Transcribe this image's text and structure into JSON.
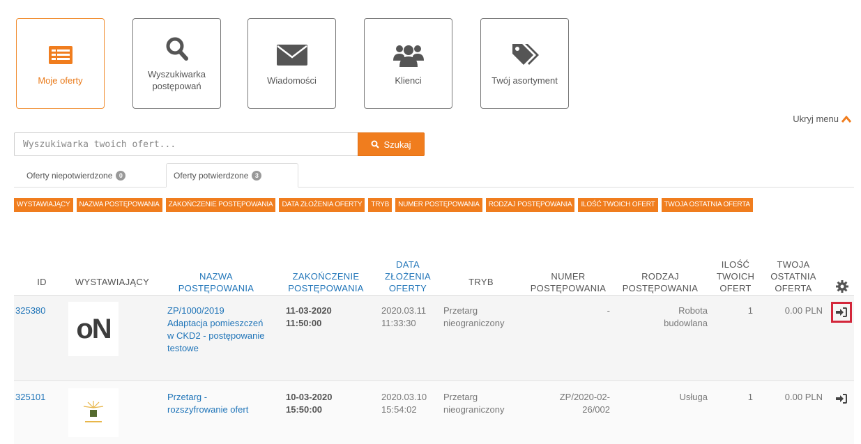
{
  "menu": {
    "tiles": [
      {
        "label": "Moje oferty",
        "icon": "list-icon"
      },
      {
        "label": "Wyszukiwarka postępowań",
        "icon": "search-icon"
      },
      {
        "label": "Wiadomości",
        "icon": "envelope-icon"
      },
      {
        "label": "Klienci",
        "icon": "users-icon"
      },
      {
        "label": "Twój asortyment",
        "icon": "tags-icon"
      }
    ],
    "hide_label": "Ukryj menu"
  },
  "search": {
    "placeholder": "Wyszukiwarka twoich ofert...",
    "button_label": "Szukaj"
  },
  "tabs": [
    {
      "label": "Oferty niepotwierdzone",
      "count": "0"
    },
    {
      "label": "Oferty potwierdzone",
      "count": "3"
    }
  ],
  "column_filters": [
    "WYSTAWIAJĄCY",
    "NAZWA POSTĘPOWANIA",
    "ZAKOŃCZENIE POSTĘPOWANIA",
    "DATA ZŁOŻENIA OFERTY",
    "TRYB",
    "NUMER POSTĘPOWANIA",
    "RODZAJ POSTĘPOWANIA",
    "ILOŚĆ TWOICH OFERT",
    "TWOJA OSTATNIA OFERTA"
  ],
  "table": {
    "headers": {
      "id": "ID",
      "issuer": "WYSTAWIAJĄCY",
      "name": "NAZWA POSTĘPOWANIA",
      "end": "ZAKOŃCZENIE POSTĘPOWANIA",
      "submitted": "DATA ZŁOŻENIA OFERTY",
      "mode": "TRYB",
      "number": "NUMER POSTĘPOWANIA",
      "kind": "RODZAJ POSTĘPOWANIA",
      "count": "ILOŚĆ TWOICH OFERT",
      "last": "TWOJA OSTATNIA OFERTA"
    },
    "rows": [
      {
        "id": "325380",
        "logo_text": "oN",
        "name": "ZP/1000/2019 Adaptacja pomieszczeń w CKD2 - postępowanie testowe",
        "end_date": "11-03-2020",
        "end_time": "11:50:00",
        "submitted_date": "2020.03.11",
        "submitted_time": "11:33:30",
        "mode": "Przetarg nieograniczony",
        "number": "-",
        "kind": "Robota budowlana",
        "count": "1",
        "last": "0.00 PLN"
      },
      {
        "id": "325101",
        "logo_text": "",
        "name": "Przetarg - rozszyfrowanie ofert",
        "end_date": "10-03-2020",
        "end_time": "15:50:00",
        "submitted_date": "2020.03.10",
        "submitted_time": "15:54:02",
        "mode": "Przetarg nieograniczony",
        "number": "ZP/2020-02-26/002",
        "kind": "Usługa",
        "count": "1",
        "last": "0.00 PLN"
      }
    ]
  },
  "colors": {
    "accent": "#f07d1e",
    "link": "#1f74b8",
    "highlight": "#d3263a"
  }
}
